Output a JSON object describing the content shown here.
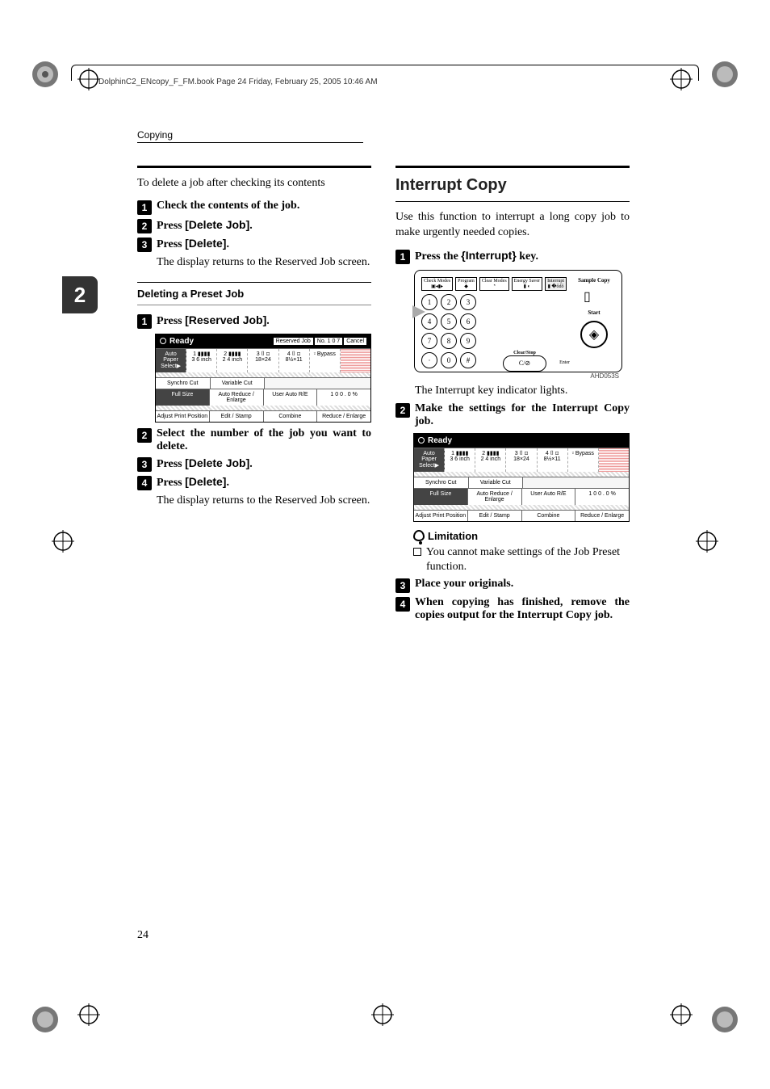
{
  "header_line": "DolphinC2_ENcopy_F_FM.book  Page 24  Friday, February 25, 2005  10:46 AM",
  "running_head": "Copying",
  "side_tab": "2",
  "page_number": "24",
  "left": {
    "intro": "To delete a job after checking its contents",
    "s1": "Check the contents of the job.",
    "s2_pre": "Press ",
    "s2_btn": "[Delete Job]",
    "s2_post": ".",
    "s3_pre": "Press ",
    "s3_btn": "[Delete]",
    "s3_post": ".",
    "s3_text": "The display returns to the Reserved Job screen.",
    "subhead": "Deleting a Preset Job",
    "p1_pre": "Press ",
    "p1_btn": "[Reserved Job]",
    "p1_post": ".",
    "p2": "Select the number of the job you want to delete.",
    "p3_pre": "Press ",
    "p3_btn": "[Delete Job]",
    "p3_post": ".",
    "p4_pre": "Press ",
    "p4_btn": "[Delete]",
    "p4_post": ".",
    "p4_text": "The display returns to the Reserved Job screen."
  },
  "right": {
    "title": "Interrupt Copy",
    "intro": "Use this function to interrupt a long copy job to make urgently needed copies.",
    "s1_pre": "Press the ",
    "s1_key": "{Interrupt}",
    "s1_post": " key.",
    "s1_text": "The Interrupt key indicator lights.",
    "s2": "Make the settings for the Interrupt Copy job.",
    "lim_head": "Limitation",
    "lim_text": "You cannot make settings of the Job Preset function.",
    "s3": "Place your originals.",
    "s4": "When copying has finished, remove the copies output for the Interrupt Copy job.",
    "fig_label": "AHD053S"
  },
  "screen": {
    "ready": "Ready",
    "reserved_job": "Reserved Job",
    "no": "No.",
    "jobno": "1 0 7",
    "cancel": "Cancel",
    "auto_paper": "Auto Paper Select▶",
    "t1a": "1 ▮▮▮▮",
    "t1b": "3 6 inch",
    "t2a": "2 ▮▮▮▮",
    "t2b": "2 4 inch",
    "t3a": "3 ⌷ ⊡",
    "t3b": "18×24",
    "t4a": "4 ⌷ ⊡",
    "t4b": "8½×11",
    "bypass": "⸚ Bypass",
    "synchro": "Synchro Cut",
    "variable": "Variable Cut",
    "fullsize": "Full Size",
    "are": "Auto Reduce / Enlarge",
    "uare": "User Auto R/E",
    "pct": "1 0 0 . 0 %",
    "adjust": "Adjust Print Position",
    "edit": "Edit / Stamp",
    "combine": "Combine",
    "reduce": "Reduce / Enlarge"
  },
  "panel": {
    "check": "Check Modes",
    "program": "Program",
    "clear": "Clear Modes",
    "energy": "Energy Saver",
    "interrupt": "Interrupt",
    "sample": "Sample Copy",
    "start": "Start",
    "clearstop": "Clear/Stop",
    "enter": "Enter",
    "k1": "1",
    "k2": "2",
    "k3": "3",
    "k4": "4",
    "k5": "5",
    "k6": "6",
    "k7": "7",
    "k8": "8",
    "k9": "9",
    "k0": "0",
    "kdot": "·",
    "khash": "#",
    "co": "C/⊘"
  }
}
